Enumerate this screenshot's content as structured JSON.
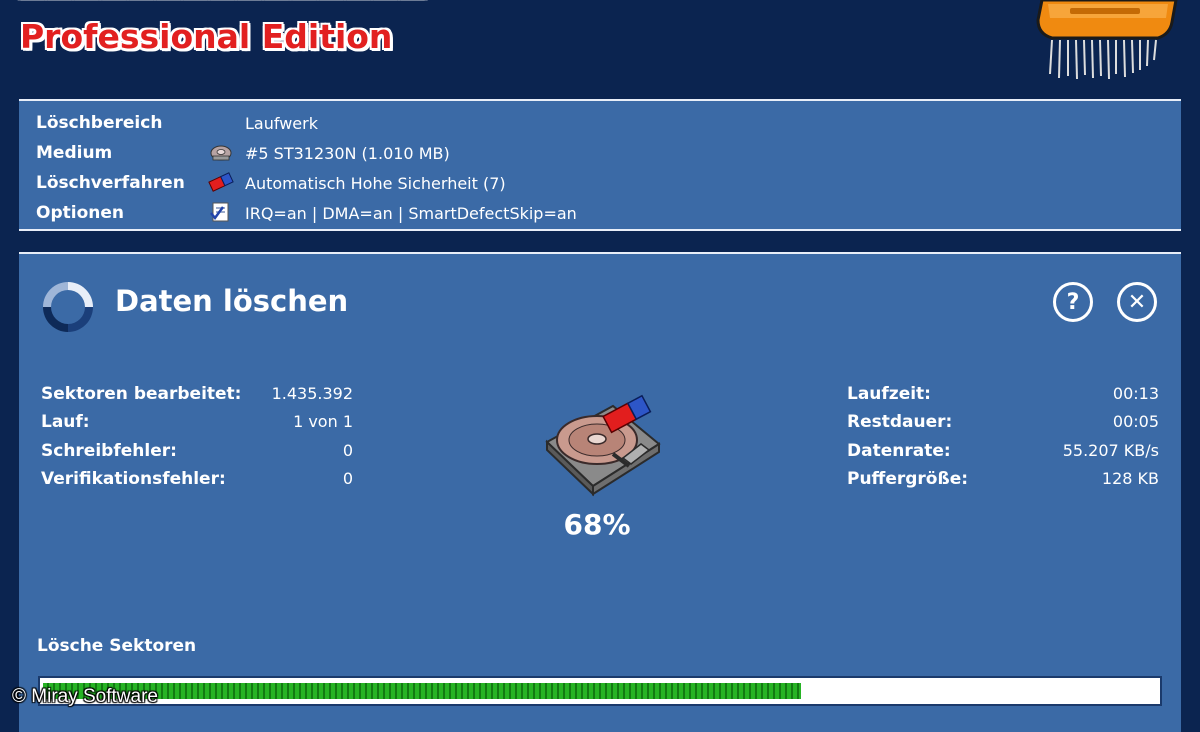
{
  "header": {
    "edition": "Professional Edition"
  },
  "info": {
    "rows": [
      {
        "label": "Löschbereich",
        "value": "Laufwerk"
      },
      {
        "label": "Medium",
        "value": "#5 ST31230N (1.010 MB)"
      },
      {
        "label": "Löschverfahren",
        "value": "Automatisch Hohe Sicherheit (7)"
      },
      {
        "label": "Optionen",
        "value": "IRQ=an  |  DMA=an  |  SmartDefectSkip=an"
      }
    ],
    "icons": [
      "hdd-small-icon",
      "eraser-icon",
      "options-checklist-icon"
    ]
  },
  "main": {
    "title": "Daten löschen",
    "help_label": "?",
    "close_label": "✕",
    "stats_left": [
      {
        "label": "Sektoren bearbeitet:",
        "value": "1.435.392"
      },
      {
        "label": "Lauf:",
        "value": "1 von 1"
      },
      {
        "label": "Schreibfehler:",
        "value": "0"
      },
      {
        "label": "Verifikationsfehler:",
        "value": "0"
      }
    ],
    "stats_right": [
      {
        "label": "Laufzeit:",
        "value": "00:13"
      },
      {
        "label": "Restdauer:",
        "value": "00:05"
      },
      {
        "label": "Datenrate:",
        "value": "55.207 KB/s"
      },
      {
        "label": "Puffergröße:",
        "value": "128 KB"
      }
    ],
    "percent": "68%",
    "progress_label": "Lösche Sektoren",
    "progress_fraction": 0.68
  },
  "copyright": "© Miray Software",
  "colors": {
    "background": "#0b2450",
    "panel": "#3b6aa6",
    "title_red": "#e22020",
    "progress_green": "#27b324"
  }
}
